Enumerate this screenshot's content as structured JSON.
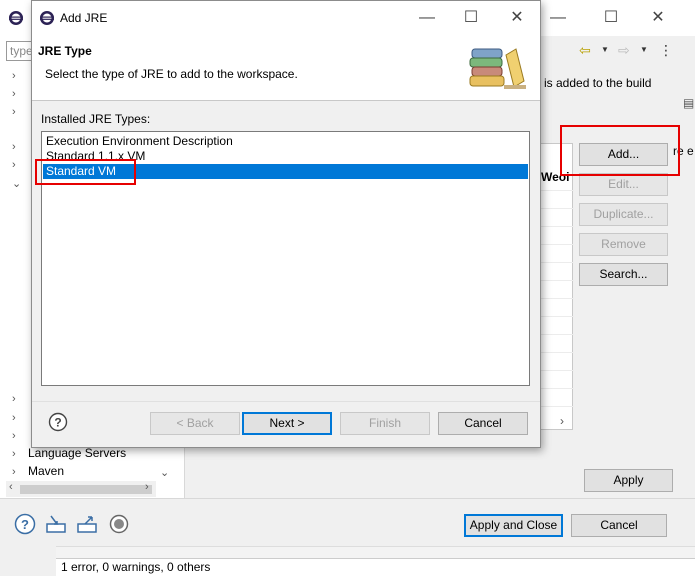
{
  "background": {
    "filter_placeholder": "type",
    "tree_items": [
      {
        "label": "Language Servers"
      },
      {
        "label": "Maven"
      }
    ],
    "description_fragment": "is added to the build",
    "side_fragment": "re e",
    "table_header_fragment": "Weoi",
    "buttons": {
      "add": "Add...",
      "edit": "Edit...",
      "duplicate": "Duplicate...",
      "remove": "Remove",
      "search": "Search...",
      "apply": "Apply",
      "apply_close": "Apply and Close",
      "cancel": "Cancel"
    },
    "status": "1 error, 0 warnings, 0 others"
  },
  "dialog": {
    "title": "Add JRE",
    "heading": "JRE Type",
    "description": "Select the type of JRE to add to the workspace.",
    "list_label": "Installed JRE Types:",
    "jre_types": [
      {
        "label": "Execution Environment Description",
        "selected": false
      },
      {
        "label": "Standard 1.1.x VM",
        "selected": false
      },
      {
        "label": "Standard VM",
        "selected": true
      }
    ],
    "buttons": {
      "back": "< Back",
      "next": "Next >",
      "finish": "Finish",
      "cancel": "Cancel"
    }
  },
  "colors": {
    "selection": "#0078d7",
    "highlight_box": "#e60000"
  }
}
